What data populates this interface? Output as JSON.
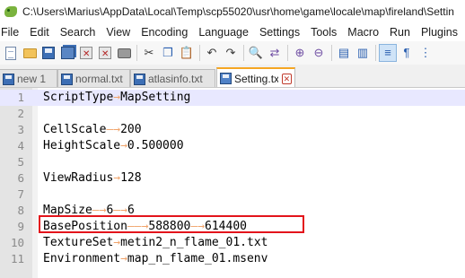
{
  "window": {
    "title": "C:\\Users\\Marius\\AppData\\Local\\Temp\\scp55020\\usr\\home\\game\\locale\\map\\fireland\\Settin"
  },
  "menu": [
    "File",
    "Edit",
    "Search",
    "View",
    "Encoding",
    "Language",
    "Settings",
    "Tools",
    "Macro",
    "Run",
    "Plugins"
  ],
  "toolbar": {
    "icons": [
      "new-file-icon",
      "open-file-icon",
      "save-icon",
      "save-all-icon",
      "close-file-icon",
      "close-all-icon",
      "print-icon",
      "cut-icon",
      "copy-icon",
      "paste-icon",
      "undo-icon",
      "redo-icon",
      "find-icon",
      "replace-icon",
      "zoom-in-icon",
      "zoom-out-icon",
      "sync-scroll-v-icon",
      "sync-scroll-h-icon",
      "word-wrap-icon",
      "show-all-chars-icon"
    ]
  },
  "tabs": [
    {
      "label": "new 1",
      "modified": true
    },
    {
      "label": "normal.txt",
      "modified": true
    },
    {
      "label": "atlasinfo.txt",
      "modified": true
    },
    {
      "label": "Setting.txt",
      "modified": false,
      "active": true
    }
  ],
  "editor": {
    "arrow_glyph": "→",
    "lines": [
      {
        "num": "1",
        "segments": [
          "ScriptType",
          "MapSetting"
        ]
      },
      {
        "num": "2",
        "segments": [
          ""
        ]
      },
      {
        "num": "3",
        "segments": [
          "CellScale",
          "200"
        ]
      },
      {
        "num": "4",
        "segments": [
          "HeightScale",
          "0.500000"
        ]
      },
      {
        "num": "5",
        "segments": [
          ""
        ]
      },
      {
        "num": "6",
        "segments": [
          "ViewRadius",
          "128"
        ]
      },
      {
        "num": "7",
        "segments": [
          ""
        ]
      },
      {
        "num": "8",
        "segments": [
          "MapSize",
          "6",
          "6"
        ]
      },
      {
        "num": "9",
        "segments": [
          "BasePosition",
          "588800",
          "614400"
        ]
      },
      {
        "num": "10",
        "segments": [
          "TextureSet",
          "metin2_n_flame_01.txt"
        ]
      },
      {
        "num": "11",
        "segments": [
          "Environment",
          "map_n_flame_01.msenv"
        ]
      }
    ],
    "current_line": "1",
    "highlighted_line": "9"
  },
  "colors": {
    "highlight_box": "#e3141b",
    "tab_accent": "#f5a623",
    "whitespace_arrow": "#f0a36a",
    "current_line_bg": "#e8e8ff"
  }
}
